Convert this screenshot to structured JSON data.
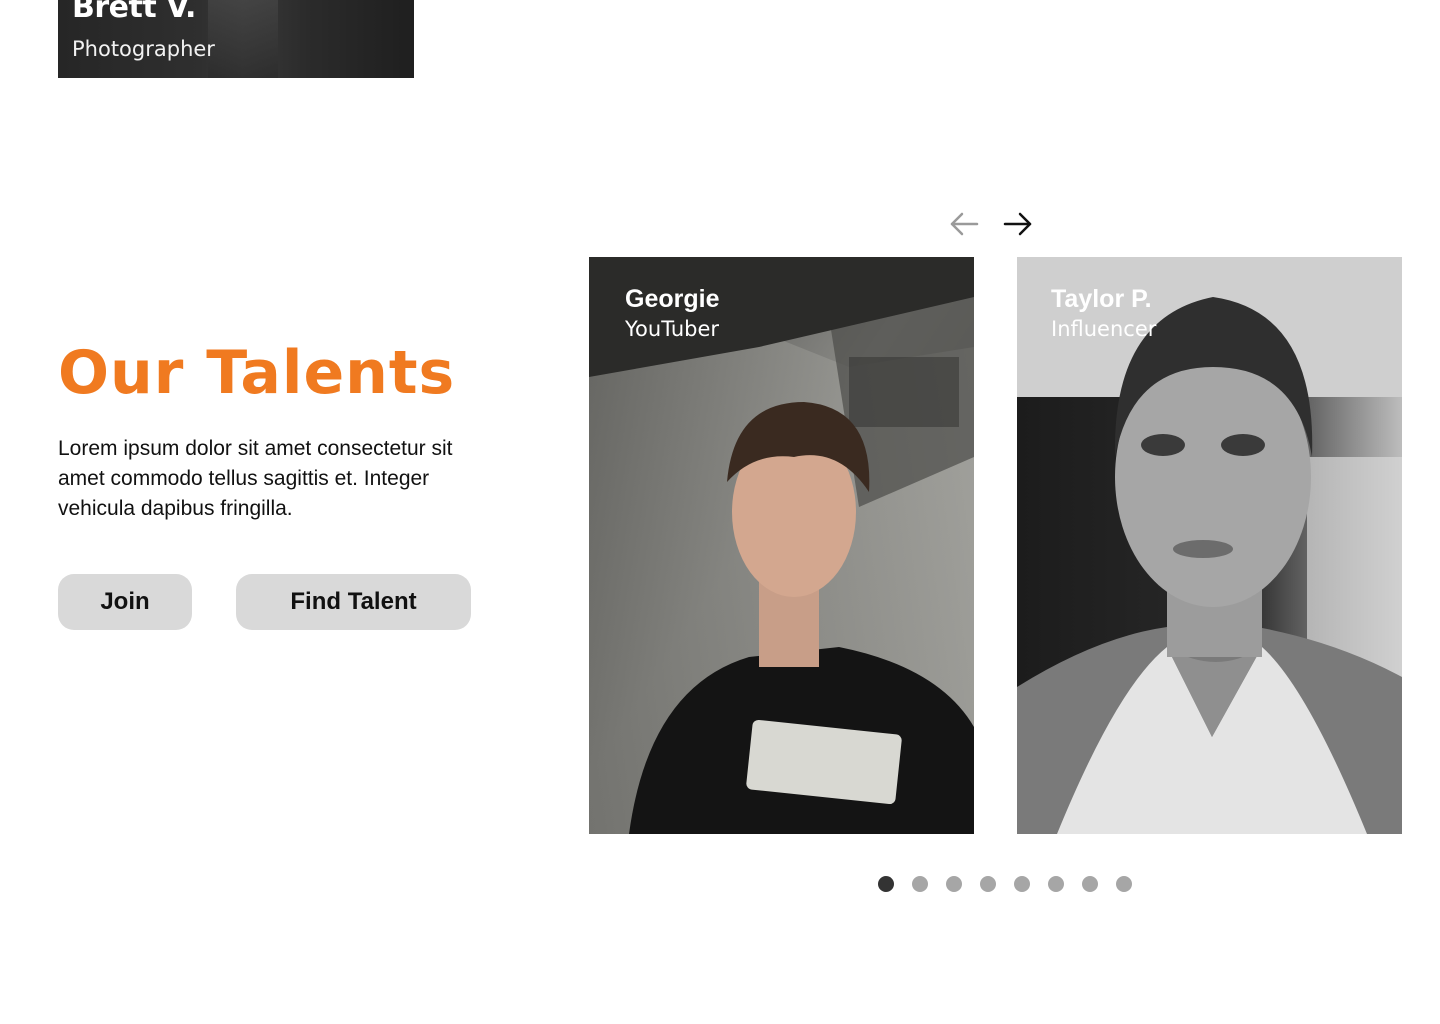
{
  "top_card": {
    "name": "Brett V.",
    "role": "Photographer"
  },
  "section": {
    "title": "Our Talents",
    "description": "Lorem ipsum dolor sit amet consectetur sit amet commodo tellus sagittis et. Integer vehicula dapibus fringilla.",
    "join_label": "Join",
    "find_label": "Find Talent"
  },
  "carousel": {
    "prev_icon": "arrow-left-icon",
    "next_icon": "arrow-right-icon",
    "cards": [
      {
        "name": "Georgie",
        "role": "YouTuber"
      },
      {
        "name": "Taylor P.",
        "role": "Influencer"
      }
    ],
    "dot_count": 8,
    "active_dot": 1
  },
  "colors": {
    "accent": "#f07a20",
    "button_bg": "#d9d9d9",
    "dot_active": "#333333",
    "dot_inactive": "#a6a6a6"
  }
}
